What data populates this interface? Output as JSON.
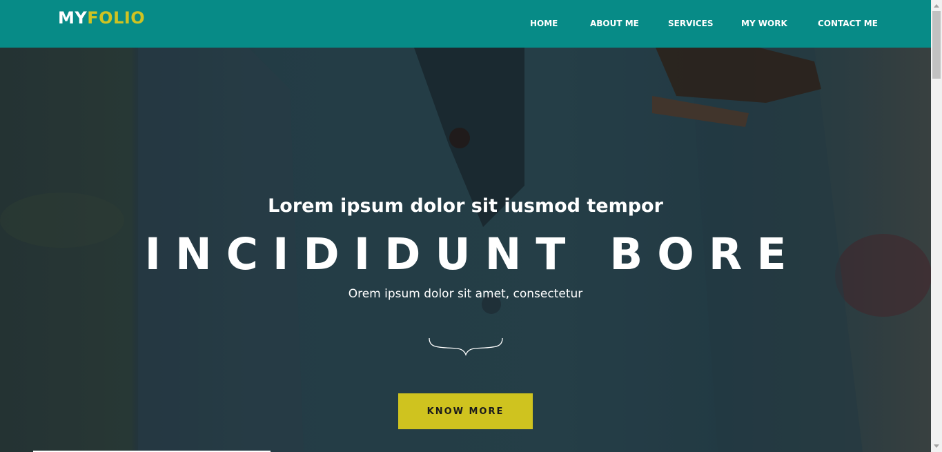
{
  "brand": {
    "part1": "MY",
    "part2": "FOLIO",
    "color_primary": "#ffffff",
    "color_accent": "#cfc322"
  },
  "nav": {
    "background": "#078b87",
    "items": [
      {
        "label": "HOME"
      },
      {
        "label": "ABOUT ME"
      },
      {
        "label": "SERVICES"
      },
      {
        "label": "MY WORK"
      },
      {
        "label": "CONTACT ME"
      }
    ]
  },
  "hero": {
    "subtitle": "Lorem ipsum dolor sit iusmod tempor",
    "title": "INCIDIDUNT BORE",
    "caption": "Orem ipsum dolor sit amet, consectetur",
    "divider_icon": "curly-brace-icon",
    "cta_label": "KNOW MORE",
    "cta_color": "#cfc31f"
  }
}
